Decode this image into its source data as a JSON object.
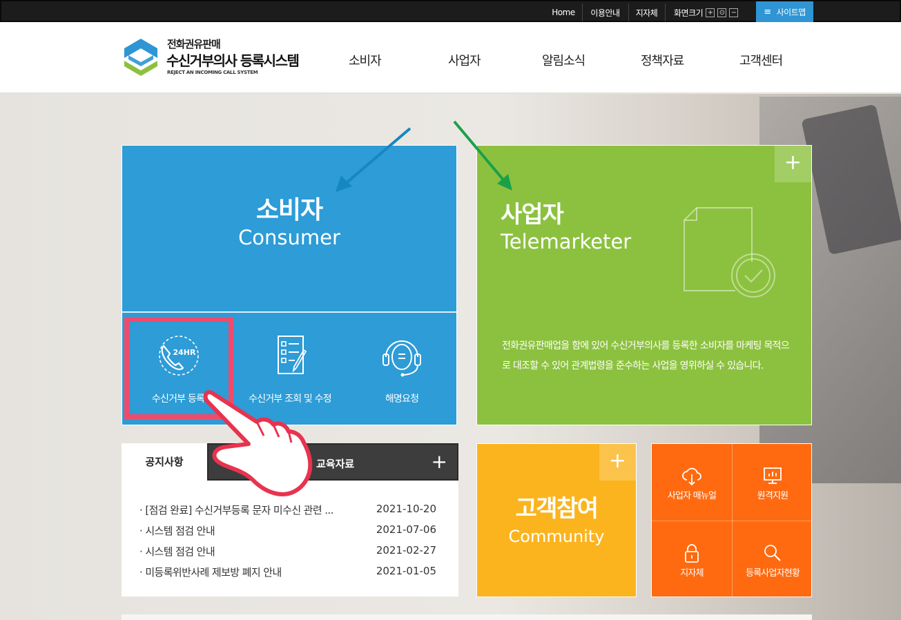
{
  "topbar": {
    "home": "Home",
    "guide": "이용안내",
    "local": "지자체",
    "screen_size": "화면크기",
    "zoom_in": "+",
    "zoom_reset": "⊙",
    "zoom_out": "−",
    "sitemap": "사이트맵"
  },
  "logo": {
    "line1": "전화권유판매",
    "line2": "수신거부의사 등록시스템",
    "line3": "REJECT AN INCOMING CALL SYSTEM"
  },
  "nav": [
    "소비자",
    "사업자",
    "알림소식",
    "정책자료",
    "고객센터"
  ],
  "consumer": {
    "title": "소비자",
    "subtitle": "Consumer",
    "items": [
      {
        "label": "수신거부 등록",
        "icon": "24hr-phone-icon"
      },
      {
        "label": "수신거부 조회 및 수정",
        "icon": "checklist-icon"
      },
      {
        "label": "해명요청",
        "icon": "headset-icon"
      }
    ]
  },
  "business": {
    "title": "사업자",
    "subtitle": "Telemarketer",
    "plus": "+",
    "description": "전화권유판매업을 함에 있어 수신거부의사를 등록한 소비자를 마케팅 목적으로 대조할 수 있어 관계법령을 준수하는 사업을 영위하실 수 있습니다."
  },
  "notice": {
    "tab_active": "공지사항",
    "tab_other": "교육자료",
    "plus": "+",
    "items": [
      {
        "title": "· [점검 완료] 수신거부등록 문자 미수신 관련 ...",
        "date": "2021-10-20"
      },
      {
        "title": "· 시스템 점검 안내",
        "date": "2021-07-06"
      },
      {
        "title": "· 시스템 점검 안내",
        "date": "2021-02-27"
      },
      {
        "title": "· 미등록위반사례 제보방 폐지 안내",
        "date": "2021-01-05"
      }
    ]
  },
  "community": {
    "title": "고객참여",
    "subtitle": "Community",
    "plus": "+"
  },
  "quick": [
    {
      "label": "사업자 매뉴얼",
      "icon": "cloud-download-icon"
    },
    {
      "label": "원격지원",
      "icon": "monitor-icon"
    },
    {
      "label": "지자체",
      "icon": "lock-icon"
    },
    {
      "label": "등록사업자현황",
      "icon": "search-icon"
    }
  ],
  "colors": {
    "consumer": "#2d9cd7",
    "business": "#8cc13f",
    "community": "#fbb41e",
    "quick": "#ff6a10",
    "highlight": "#f04b6a",
    "sitemap": "#2f95d4"
  }
}
